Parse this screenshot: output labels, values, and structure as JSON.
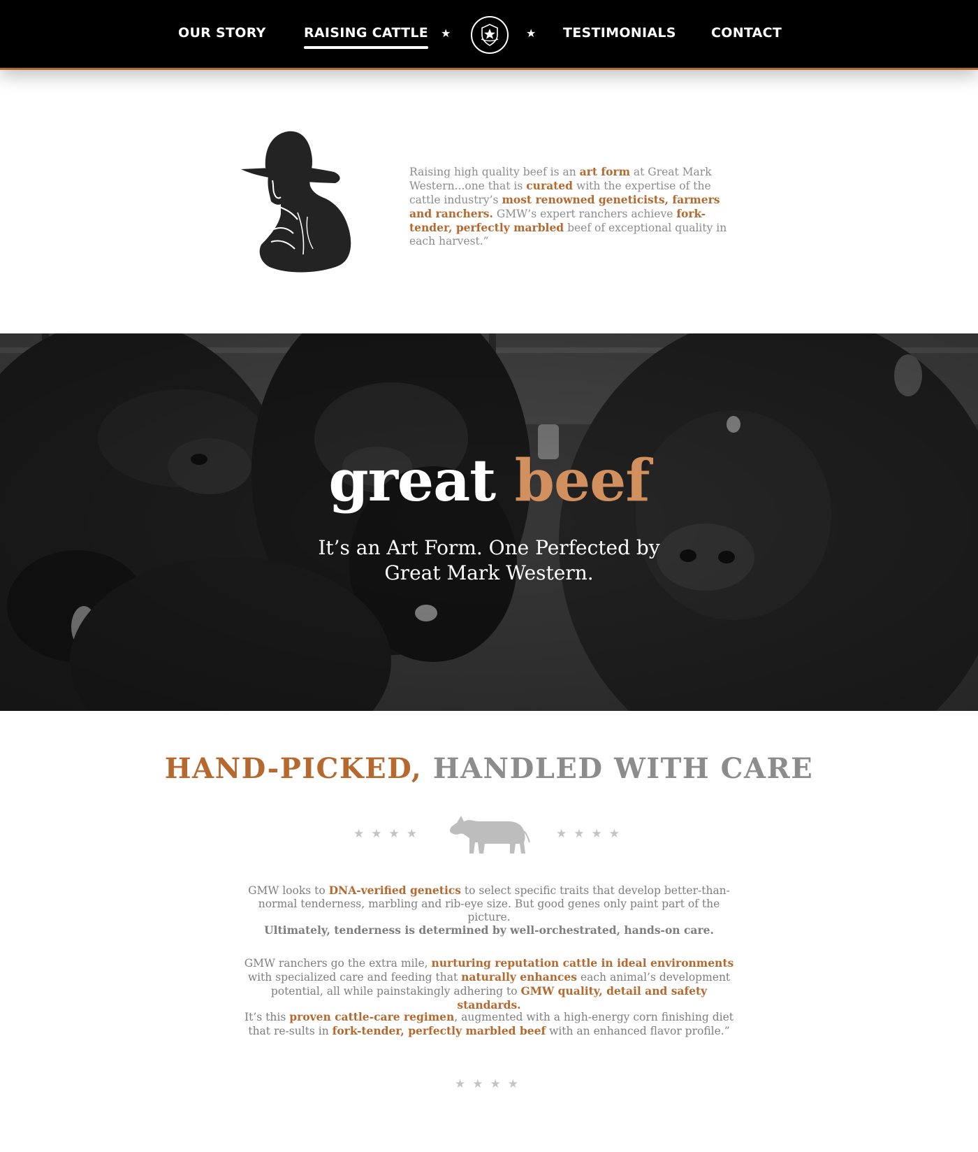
{
  "nav": {
    "items": [
      "OUR STORY",
      "RAISING CATTLE",
      "TESTIMONIALS",
      "CONTACT"
    ],
    "active": "RAISING CATTLE",
    "star_glyph": "★",
    "logo_icon": "shield-star-icon"
  },
  "intro": {
    "figure_icon": "cowboy-silhouette-icon",
    "p": [
      "Raising high quality beef is an ",
      "art form",
      " at Great Mark Western...one that is ",
      "curated",
      " with the expertise of the cattle industry’s ",
      "most renowned geneticists, farmers and ranchers.",
      " GMW’s expert ranchers achieve ",
      "fork-tender, perfectly marbled",
      " beef of exceptional quality in each harvest.”"
    ]
  },
  "hero": {
    "title_white": "great",
    "title_accent": "beef",
    "subtitle_line1": "It’s an Art Form. One Perfected by",
    "subtitle_line2": "Great Mark Western."
  },
  "section": {
    "heading_accent": "HAND-PICKED,",
    "heading_rest": " HANDLED WITH CARE",
    "divider_icon": "cow-icon",
    "stars": "★★★★",
    "p1": [
      "GMW looks to ",
      "DNA-verified genetics",
      " to select specific traits that develop better-than-normal tenderness, marbling and rib-eye size. But good genes only paint part of the picture."
    ],
    "p2": "Ultimately, tenderness is determined by well-orchestrated, hands-on care.",
    "p3": [
      "GMW ranchers go the extra mile, ",
      "nurturing reputation cattle in ideal environments",
      " with specialized care and feeding that ",
      "naturally enhances",
      " each animal’s development potential, all while painstakingly adhering to ",
      "GMW quality, detail and safety standards."
    ],
    "p4": [
      "It’s this ",
      "proven cattle-care regimen",
      ", augmented with a high-energy corn finishing diet that re-sults in ",
      "fork-tender, perfectly marbled beef",
      " with an enhanced flavor profile.”"
    ]
  },
  "colors": {
    "accent": "#b5692f",
    "accent_light": "#d2905e",
    "nav_bg": "#000000",
    "body_text": "#8c8c8c"
  }
}
